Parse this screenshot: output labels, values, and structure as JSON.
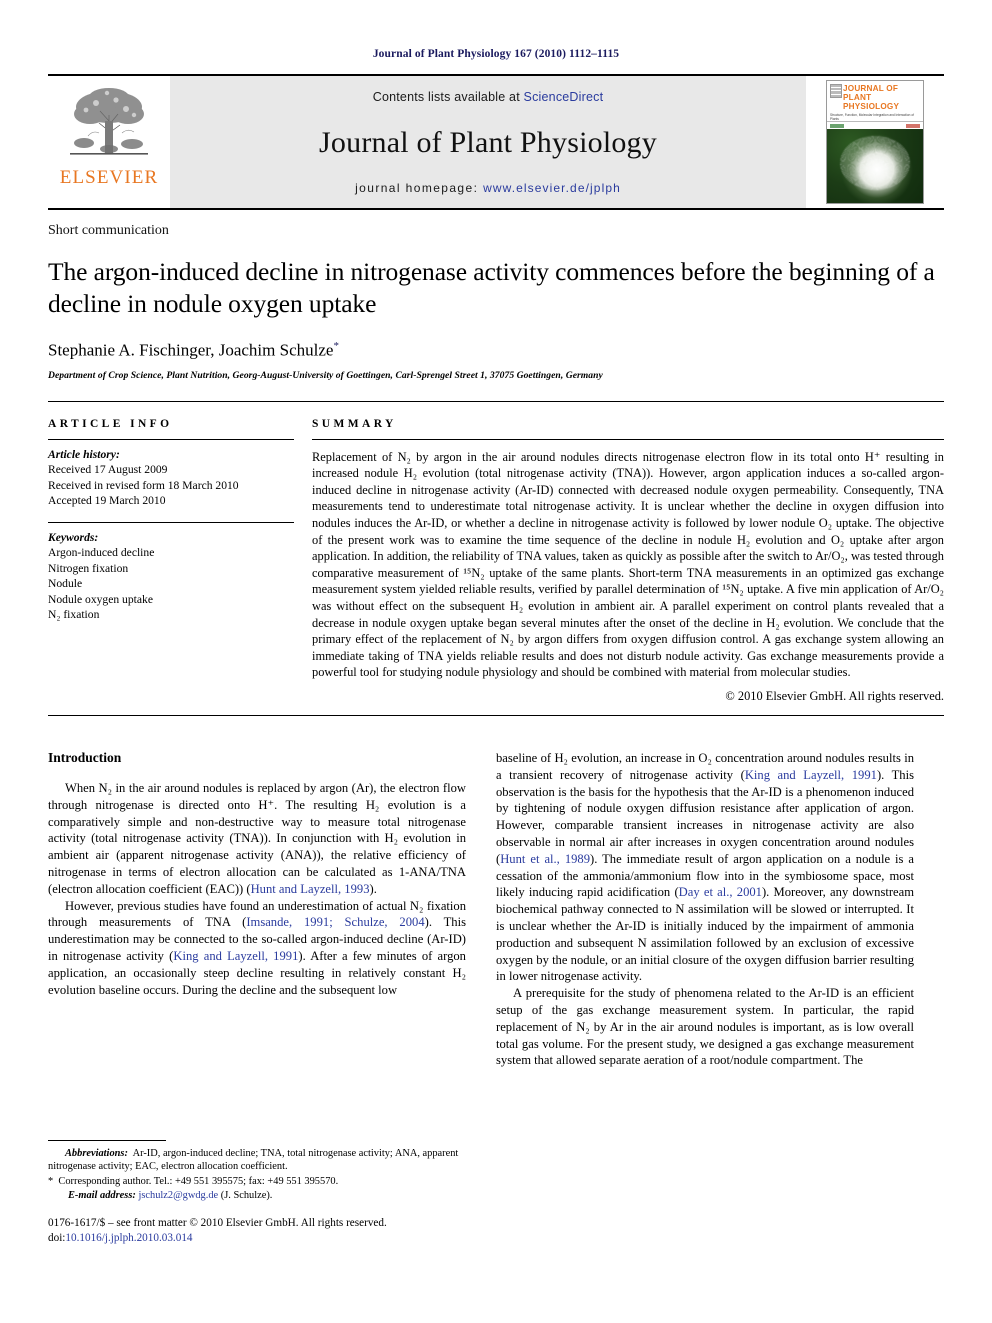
{
  "running_head": "Journal of Plant Physiology 167 (2010) 1112–1115",
  "masthead": {
    "publisher_wordmark": "ELSEVIER",
    "contents_prefix": "Contents lists available at ",
    "contents_link": "ScienceDirect",
    "journal_name": "Journal of Plant Physiology",
    "homepage_prefix": "journal homepage: ",
    "homepage_url": "www.elsevier.de/jplph",
    "cover_title_line1": "JOURNAL OF",
    "cover_title_line2": "PLANT PHYSIOLOGY",
    "cover_subtitle": "Structure, Function, Molecular Integration and Interaction of Plants"
  },
  "article": {
    "type": "Short communication",
    "title": "The argon-induced decline in nitrogenase activity commences before the beginning of a decline in nodule oxygen uptake",
    "authors": "Stephanie A. Fischinger, Joachim Schulze",
    "corresponding_marker": "*",
    "affiliation": "Department of Crop Science, Plant Nutrition, Georg-August-University of Goettingen, Carl-Sprengel Street 1, 37075 Goettingen, Germany"
  },
  "article_info": {
    "heading": "ARTICLE INFO",
    "history_label": "Article history:",
    "history": [
      "Received 17 August 2009",
      "Received in revised form 18 March 2010",
      "Accepted 19 March 2010"
    ],
    "keywords_label": "Keywords:",
    "keywords": [
      "Argon-induced decline",
      "Nitrogen fixation",
      "Nodule",
      "Nodule oxygen uptake",
      "N₂ fixation"
    ]
  },
  "summary": {
    "heading": "SUMMARY",
    "text": "Replacement of N₂ by argon in the air around nodules directs nitrogenase electron flow in its total onto H⁺ resulting in increased nodule H₂ evolution (total nitrogenase activity (TNA)). However, argon application induces a so-called argon-induced decline in nitrogenase activity (Ar-ID) connected with decreased nodule oxygen permeability. Consequently, TNA measurements tend to underestimate total nitrogenase activity. It is unclear whether the decline in oxygen diffusion into nodules induces the Ar-ID, or whether a decline in nitrogenase activity is followed by lower nodule O₂ uptake. The objective of the present work was to examine the time sequence of the decline in nodule H₂ evolution and O₂ uptake after argon application. In addition, the reliability of TNA values, taken as quickly as possible after the switch to Ar/O₂, was tested through comparative measurement of ¹⁵N₂ uptake of the same plants. Short-term TNA measurements in an optimized gas exchange measurement system yielded reliable results, verified by parallel determination of ¹⁵N₂ uptake. A five min application of Ar/O₂ was without effect on the subsequent H₂ evolution in ambient air. A parallel experiment on control plants revealed that a decrease in nodule oxygen uptake began several minutes after the onset of the decline in H₂ evolution. We conclude that the primary effect of the replacement of N₂ by argon differs from oxygen diffusion control. A gas exchange system allowing an immediate taking of TNA yields reliable results and does not disturb nodule activity. Gas exchange measurements provide a powerful tool for studying nodule physiology and should be combined with material from molecular studies.",
    "copyright": "© 2010 Elsevier GmbH. All rights reserved."
  },
  "body": {
    "intro_heading": "Introduction",
    "left_p1_a": "When N₂ in the air around nodules is replaced by argon (Ar), the electron flow through nitrogenase is directed onto H⁺. The resulting H₂ evolution is a comparatively simple and non-destructive way to measure total nitrogenase activity (total nitrogenase activity (TNA)). In conjunction with H₂ evolution in ambient air (apparent nitrogenase activity (ANA)), the relative efficiency of nitrogenase in terms of electron allocation can be calculated as 1-ANA/TNA (electron allocation coefficient (EAC)) (",
    "left_p1_cite": "Hunt and Layzell, 1993",
    "left_p1_b": ").",
    "left_p2_a": "However, previous studies have found an underestimation of actual N₂ fixation through measurements of TNA (",
    "left_p2_cite1": "Imsande, 1991; Schulze, 2004",
    "left_p2_b": "). This underestimation may be connected to the so-called argon-induced decline (Ar-ID) in nitrogenase activity (",
    "left_p2_cite2": "King and Layzell, 1991",
    "left_p2_c": "). After a few minutes of argon application, an occasionally steep decline resulting in relatively constant H₂ evolution baseline occurs. During the decline and the subsequent low",
    "right_p1_a": "baseline of H₂ evolution, an increase in O₂ concentration around nodules results in a transient recovery of nitrogenase activity (",
    "right_p1_cite1": "King and Layzell, 1991",
    "right_p1_b": "). This observation is the basis for the hypothesis that the Ar-ID is a phenomenon induced by tightening of nodule oxygen diffusion resistance after application of argon. However, comparable transient increases in nitrogenase activity are also observable in normal air after increases in oxygen concentration around nodules (",
    "right_p1_cite2": "Hunt et al., 1989",
    "right_p1_c": "). The immediate result of argon application on a nodule is a cessation of the ammonia/ammonium flow into in the symbiosome space, most likely inducing rapid acidification (",
    "right_p1_cite3": "Day et al., 2001",
    "right_p1_d": "). Moreover, any downstream biochemical pathway connected to N assimilation will be slowed or interrupted. It is unclear whether the Ar-ID is initially induced by the impairment of ammonia production and subsequent N assimilation followed by an exclusion of excessive oxygen by the nodule, or an initial closure of the oxygen diffusion barrier resulting in lower nitrogenase activity.",
    "right_p2": "A prerequisite for the study of phenomena related to the Ar-ID is an efficient setup of the gas exchange measurement system. In particular, the rapid replacement of N₂ by Ar in the air around nodules is important, as is low overall total gas volume. For the present study, we designed a gas exchange measurement system that allowed separate aeration of a root/nodule compartment. The"
  },
  "footnotes": {
    "abbrev_label": "Abbreviations:",
    "abbrev_text": "Ar-ID, argon-induced decline; TNA, total nitrogenase activity; ANA, apparent nitrogenase activity; EAC, electron allocation coefficient.",
    "corresponding_star": "*",
    "corresponding_text": "Corresponding author. Tel.: +49 551 395575; fax: +49 551 395570.",
    "email_label": "E-mail address:",
    "email": "jschulz2@gwdg.de",
    "email_suffix": " (J. Schulze).",
    "issn_line": "0176-1617/$ – see front matter © 2010 Elsevier GmbH. All rights reserved.",
    "doi_label": "doi:",
    "doi": "10.1016/j.jplph.2010.03.014"
  },
  "colors": {
    "link_blue": "#2a3b9e",
    "elsevier_orange": "#E87722",
    "running_head_navy": "#1a1a5e"
  }
}
